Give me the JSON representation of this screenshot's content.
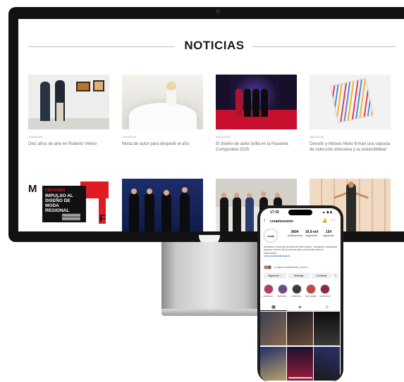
{
  "website": {
    "heading": "NOTICIAS",
    "news": [
      {
        "date": "12/03/2025",
        "title": "Diez años de arte en Roberto Verino"
      },
      {
        "date": "12/03/2025",
        "title": "Moda de autor para despedir el año"
      },
      {
        "date": "20/02/2025",
        "title": "El diseño de autor brilla en la Pasarela Compostela 2025"
      },
      {
        "date": "18/02/2025",
        "title": "Deroxhi y Moisés Nieto firman una cápsula de colección artesanía y la sostenibilidad"
      },
      {
        "date": "",
        "title": ""
      },
      {
        "date": "",
        "title": ""
      },
      {
        "date": "",
        "title": ""
      },
      {
        "date": "",
        "title": ""
      }
    ],
    "poster": {
      "letter_m": "M",
      "letter_f": "F",
      "small": "CERTAMEN",
      "lines": [
        "IMPULSO AL",
        "DISEÑO DE",
        "MODA",
        "REGIONAL"
      ]
    }
  },
  "phone": {
    "status": {
      "time": "17:32",
      "icons": "▲ ◆ ▮"
    },
    "header": {
      "back": "‹",
      "username": "creadoresmm",
      "bell": "🔔",
      "more": "⋯"
    },
    "profile": {
      "avatar_text": "moda",
      "stats": [
        {
          "value": "3804",
          "label": "publicaciones"
        },
        {
          "value": "16,9 mil",
          "label": "seguidores"
        },
        {
          "value": "154",
          "label": "siguiendo"
        }
      ]
    },
    "bio": "Asociación Creadores de Moda de Extremadura · Asociación creada para impulsar el sector de la moda de autor y la industria textil de Extremadura.",
    "link": "www.creadoresdemoda.es",
    "followed": "Le siguen creadoresmm y otros 3",
    "buttons": [
      "Siguiendo ⌄",
      "Mensaje",
      "Contactar",
      "+"
    ],
    "highlights": [
      "MODA ALC..",
      "MODA DE...",
      "COMUNICA...",
      "MOLA MODA",
      "NAVIDAD 24"
    ],
    "tabs": {
      "grid": "▦",
      "reels": "▶",
      "tagged": "◎"
    }
  },
  "colors": {
    "bezel": "#121212",
    "accent_red": "#e01b22",
    "heading_text": "#1a1a1a",
    "meta_text": "#9a9a9a"
  }
}
